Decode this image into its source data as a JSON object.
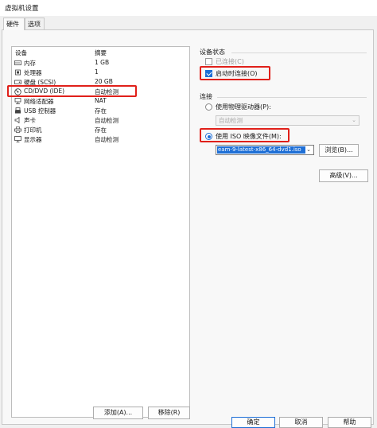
{
  "window": {
    "title": "虚拟机设置"
  },
  "tabs": [
    {
      "label": "硬件"
    },
    {
      "label": "选项"
    }
  ],
  "device_list": {
    "header_device": "设备",
    "header_summary": "摘要",
    "rows": [
      {
        "label": "内存",
        "value": "1 GB",
        "icon": "memory-icon"
      },
      {
        "label": "处理器",
        "value": "1",
        "icon": "processor-icon"
      },
      {
        "label": "硬盘 (SCSI)",
        "value": "20 GB",
        "icon": "hard-disk-icon"
      },
      {
        "label": "CD/DVD (IDE)",
        "value": "自动检测",
        "icon": "cd-dvd-icon"
      },
      {
        "label": "网络适配器",
        "value": "NAT",
        "icon": "network-adapter-icon"
      },
      {
        "label": "USB 控制器",
        "value": "存在",
        "icon": "usb-icon"
      },
      {
        "label": "声卡",
        "value": "自动检测",
        "icon": "sound-card-icon"
      },
      {
        "label": "打印机",
        "value": "存在",
        "icon": "printer-icon"
      },
      {
        "label": "显示器",
        "value": "自动检测",
        "icon": "display-icon"
      }
    ],
    "selected_index": 3
  },
  "list_buttons": {
    "add": "添加(A)...",
    "remove": "移除(R)"
  },
  "device_status": {
    "title": "设备状态",
    "connected_label": "已连接(C)",
    "connected": false,
    "connect_at_power_on_label": "启动时连接(O)",
    "connect_at_power_on": true
  },
  "connection": {
    "title": "连接",
    "physical_drive_label": "使用物理驱动器(P):",
    "physical_drive_value": "自动检测",
    "iso_label": "使用 ISO 映像文件(M):",
    "iso_value": "eam-9-latest-x86_64-dvd1.iso",
    "browse": "浏览(B)...",
    "selected": "iso"
  },
  "advanced_button": "高级(V)...",
  "footer": {
    "ok": "确定",
    "cancel": "取消",
    "help": "帮助"
  },
  "colors": {
    "highlight": "#e0201a",
    "accent": "#1e6fd6",
    "dialog_bg": "#f0f0f0"
  }
}
